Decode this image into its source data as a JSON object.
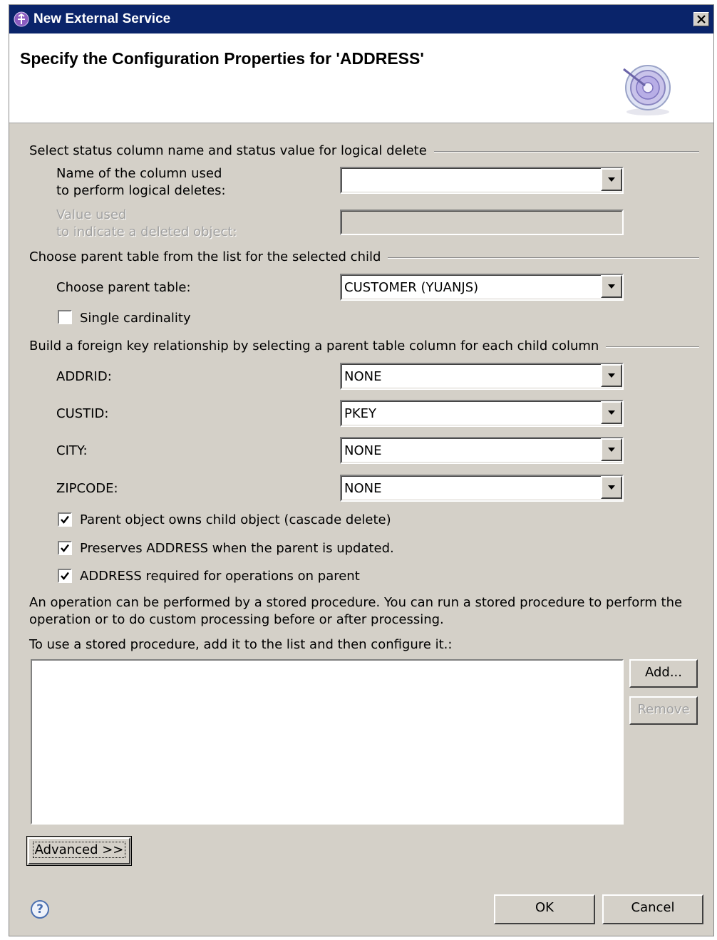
{
  "window": {
    "title": "New External Service",
    "close_icon": "close-icon"
  },
  "header": {
    "title": "Specify the Configuration Properties for 'ADDRESS'"
  },
  "logical_delete": {
    "section_title": "Select status column name and status value for logical delete",
    "column_label_line1": "Name of the column used",
    "column_label_line2": "to perform logical deletes:",
    "column_value": "",
    "value_label_line1": "Value used",
    "value_label_line2": "to indicate a deleted object:",
    "value_field": ""
  },
  "parent_table": {
    "section_title": "Choose parent table from the list for the selected child",
    "label": "Choose parent table:",
    "value": "CUSTOMER (YUANJS)",
    "single_cardinality_label": "Single cardinality",
    "single_cardinality_checked": false
  },
  "foreign_key": {
    "section_title": "Build a foreign key relationship by selecting a parent table column for each child column",
    "rows": [
      {
        "label": "ADDRID:",
        "value": "NONE"
      },
      {
        "label": "CUSTID:",
        "value": "PKEY"
      },
      {
        "label": "CITY:",
        "value": "NONE"
      },
      {
        "label": "ZIPCODE:",
        "value": "NONE"
      }
    ]
  },
  "options": [
    {
      "label": "Parent object owns child object (cascade delete)",
      "checked": true
    },
    {
      "label": "Preserves ADDRESS when the parent is updated.",
      "checked": true
    },
    {
      "label": "ADDRESS required for operations on parent",
      "checked": true
    }
  ],
  "stored_procedure": {
    "desc_line1": "An operation can be performed by a stored procedure. You can run a stored procedure to perform the",
    "desc_line2": "operation or to do custom processing before or after processing.",
    "instruction": "To use a stored procedure, add it to the list and then configure it.:",
    "items": [],
    "add_label": "Add...",
    "remove_label": "Remove"
  },
  "buttons": {
    "advanced": "Advanced >>",
    "ok": "OK",
    "cancel": "Cancel",
    "help_icon": "help-icon"
  }
}
